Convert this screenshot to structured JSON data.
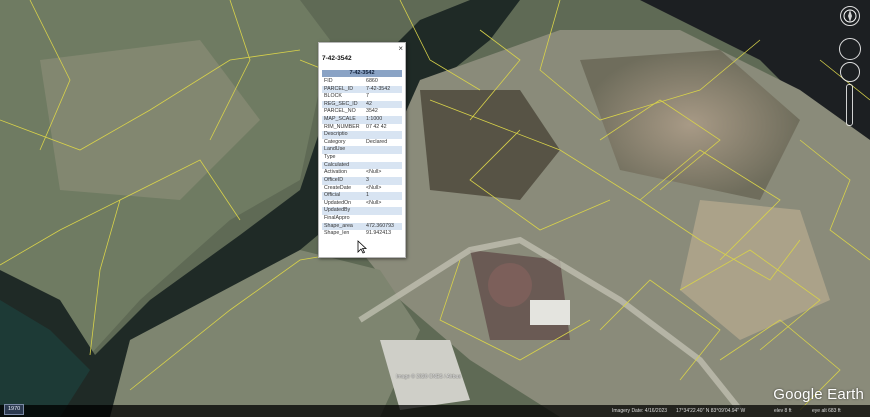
{
  "popup": {
    "title": "7-42-3542",
    "header": "7-42-3542",
    "close_symbol": "×",
    "rows": [
      {
        "key": "FID",
        "value": "6860"
      },
      {
        "key": "PARCEL_ID",
        "value": "7-42-3542"
      },
      {
        "key": "BLOCK",
        "value": "7"
      },
      {
        "key": "REG_SEC_ID",
        "value": "42"
      },
      {
        "key": "PARCEL_NO",
        "value": "3542"
      },
      {
        "key": "MAP_SCALE",
        "value": "1:1000"
      },
      {
        "key": "RIM_NUMBER",
        "value": "07 42 42"
      },
      {
        "key": "Descriptio",
        "value": ""
      },
      {
        "key": "Category",
        "value": "Declared"
      },
      {
        "key": "LandUse",
        "value": ""
      },
      {
        "key": "Type",
        "value": ""
      },
      {
        "key": "Calculated",
        "value": ""
      },
      {
        "key": "Activation",
        "value": "<Null>"
      },
      {
        "key": "OfficeID",
        "value": "3"
      },
      {
        "key": "CreateDate",
        "value": "<Null>"
      },
      {
        "key": "Official",
        "value": "1"
      },
      {
        "key": "UpdatedOn",
        "value": "<Null>"
      },
      {
        "key": "UpdatedBy",
        "value": ""
      },
      {
        "key": "FinalAppro",
        "value": ""
      },
      {
        "key": "Shape_area",
        "value": "472.360793"
      },
      {
        "key": "Shape_len",
        "value": "91.942413"
      }
    ]
  },
  "imagery": {
    "credit": "Image © 2026 CNES / Airbus"
  },
  "timeline": {
    "year": "1970"
  },
  "brand": "Google Earth",
  "status_bar": {
    "date": "Imagery Date: 4/16/2023",
    "coords": "17°34'22.40\" N  83°09'04.94\" W",
    "elev": "elev  8 ft",
    "eye_alt": "eye alt  683 ft"
  },
  "colors": {
    "parcel_line": "#d8d24a",
    "popup_header": "#8aa3c5",
    "row_alt": "#d8e4f2"
  },
  "icons": [
    "compass-icon",
    "look-joystick-icon",
    "move-joystick-icon",
    "zoom-slider-icon",
    "close-icon",
    "cursor-icon"
  ]
}
